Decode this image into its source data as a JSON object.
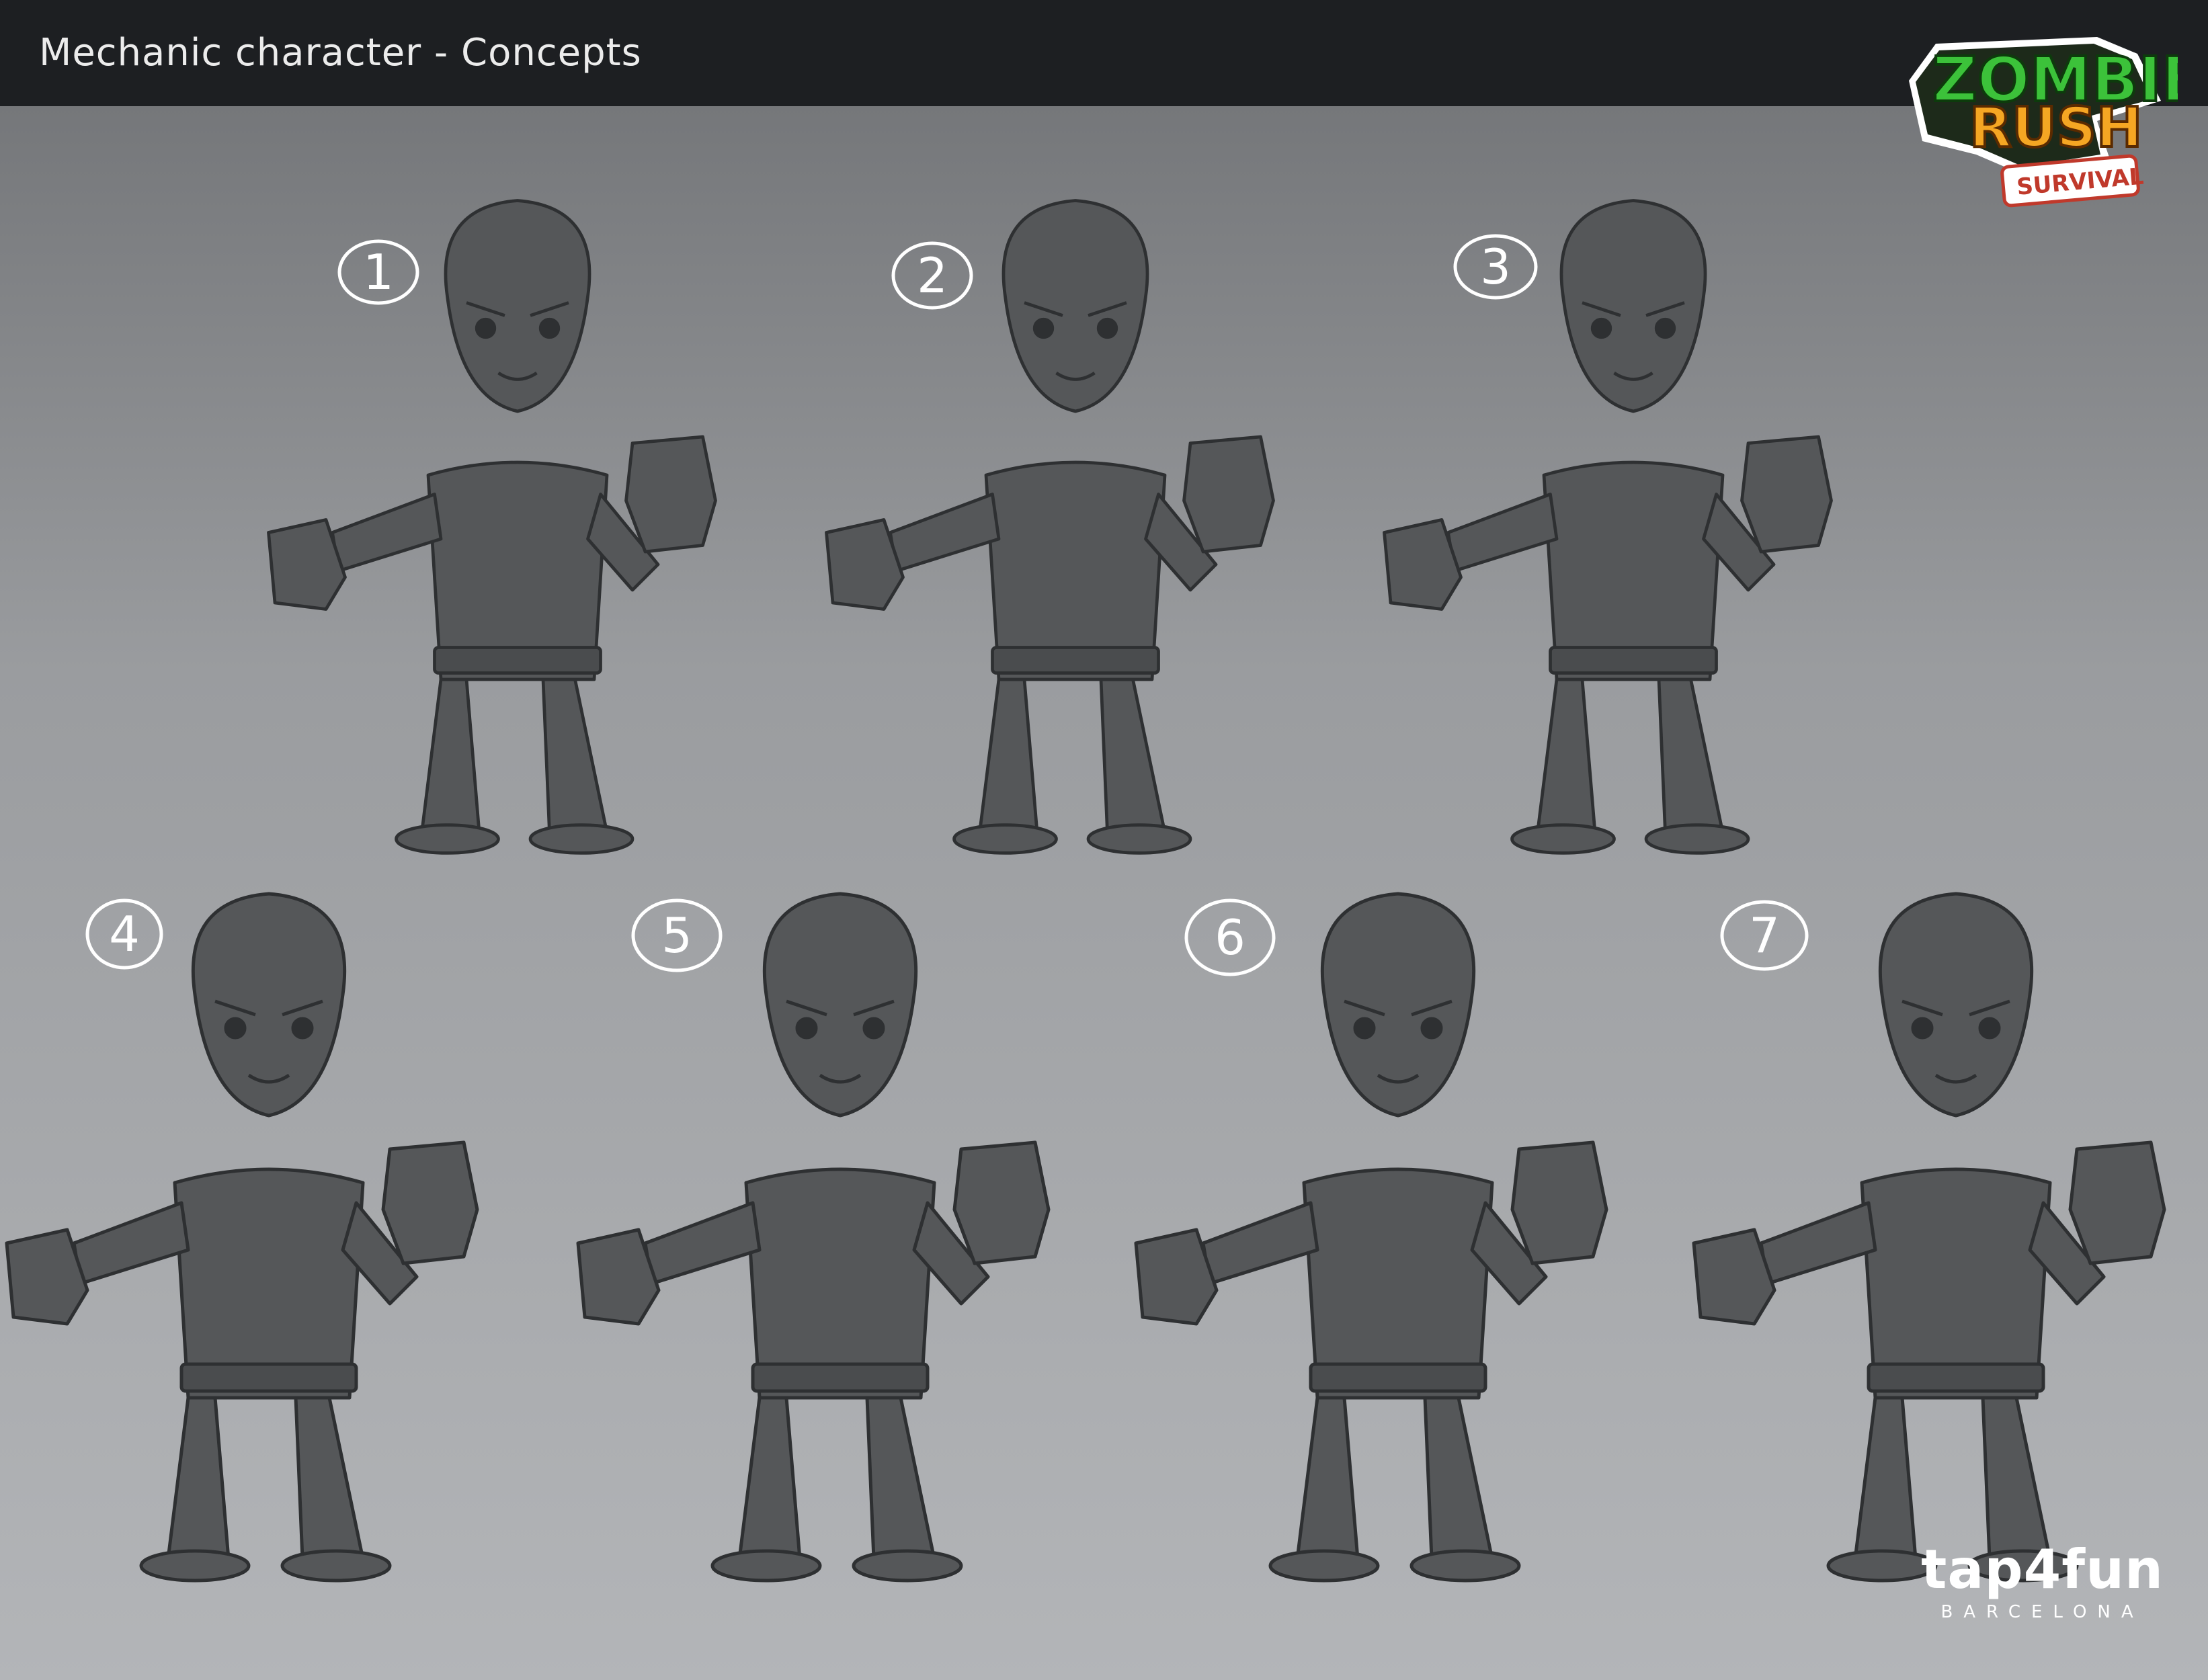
{
  "header": {
    "title": "Mechanic character - Concepts"
  },
  "logo": {
    "line1": "ZOMBIE",
    "line2": "RUSH",
    "badge": "SURVIVAL"
  },
  "concepts": [
    "1",
    "2",
    "3",
    "4",
    "5",
    "6",
    "7"
  ],
  "brand": {
    "name": "tap4fun",
    "sub": "BARCELONA"
  },
  "colors": {
    "header_bg": "#1d1f22",
    "logo_green": "#3cc23a",
    "logo_orange": "#f5a623",
    "brand_red": "#e21f26",
    "sketch_fill": "#555759",
    "sketch_line": "#2e3032"
  }
}
